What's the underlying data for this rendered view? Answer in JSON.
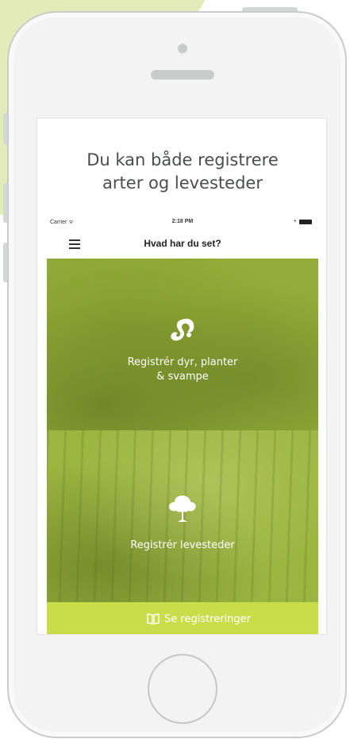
{
  "headline": {
    "line1": "Du kan både registrere",
    "line2": "arter og levesteder"
  },
  "statusbar": {
    "carrier": "Carrier ᯤ",
    "time": "2:18 PM"
  },
  "navbar": {
    "title": "Hvad har du set?"
  },
  "tiles": [
    {
      "line1": "Registrér dyr, planter",
      "line2": "& svampe",
      "icon": "squirrel-icon"
    },
    {
      "line1": "Registrér levesteder",
      "icon": "tree-icon"
    }
  ],
  "bottom_bar": {
    "label": "Se registreringer",
    "icon": "book-icon"
  },
  "colors": {
    "accent_green": "#c9dc4a",
    "tile_green": "#92ad3a",
    "background_band": "#e3ecb9"
  }
}
